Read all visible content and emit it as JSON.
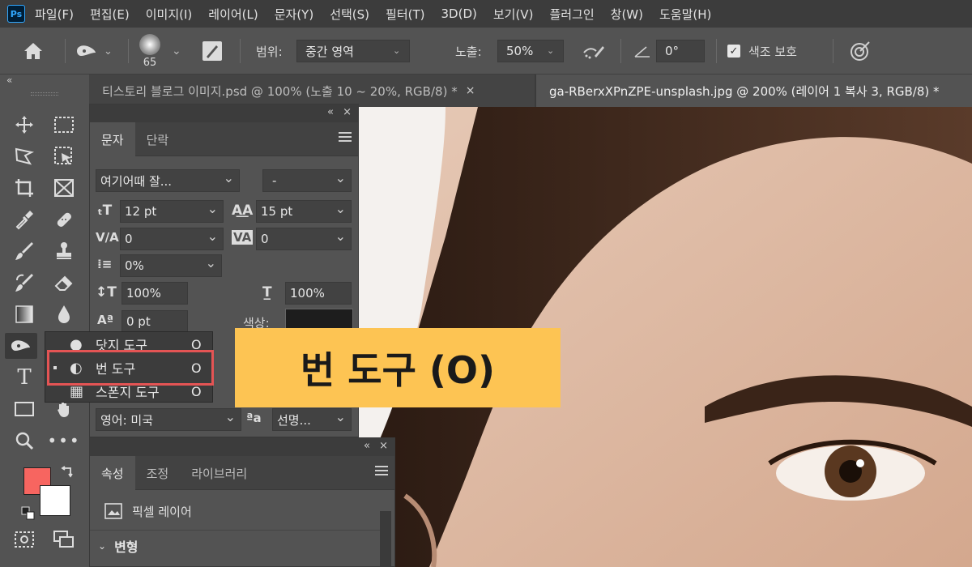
{
  "menubar": {
    "logo": "Ps",
    "items": [
      "파일(F)",
      "편집(E)",
      "이미지(I)",
      "레이어(L)",
      "문자(Y)",
      "선택(S)",
      "필터(T)",
      "3D(D)",
      "보기(V)",
      "플러그인",
      "창(W)",
      "도움말(H)"
    ]
  },
  "options": {
    "brush_size": "65",
    "range_label": "범위:",
    "range_value": "중간 영역",
    "exposure_label": "노출:",
    "exposure_value": "50%",
    "angle_value": "0°",
    "protect_label": "색조 보호"
  },
  "tabs": [
    {
      "label": "티스토리 블로그 이미지.psd @ 100% (노출 10 ~ 20%, RGB/8) *",
      "close": "×"
    },
    {
      "label": "ga-RBerxXPnZPE-unsplash.jpg @ 200% (레이어 1 복사 3, RGB/8) *"
    }
  ],
  "character_panel": {
    "tabs": [
      "문자",
      "단락"
    ],
    "font_family": "여기어때 잘...",
    "font_style": "-",
    "font_size": "12 pt",
    "leading": "15 pt",
    "kerning": "0",
    "tracking": "0",
    "tsume": "0%",
    "vertical_scale": "100%",
    "horizontal_scale": "100%",
    "baseline_shift": "0 pt",
    "color_label": "색상:",
    "language": "영어: 미국",
    "antialias_icon": "ªa",
    "antialias": "선명..."
  },
  "flyout": {
    "items": [
      {
        "label": "닷지 도구",
        "key": "O"
      },
      {
        "label": "번 도구",
        "key": "O"
      },
      {
        "label": "스폰지 도구",
        "key": "O"
      }
    ]
  },
  "callout": {
    "text": "번 도구 (O)"
  },
  "properties_panel": {
    "tabs": [
      "속성",
      "조정",
      "라이브러리"
    ],
    "layer_type": "픽셀 레이어",
    "section": "변형"
  },
  "colors": {
    "foreground": "#f76560",
    "background": "#ffffff",
    "callout": "#fdc453",
    "highlight": "#e45454"
  }
}
